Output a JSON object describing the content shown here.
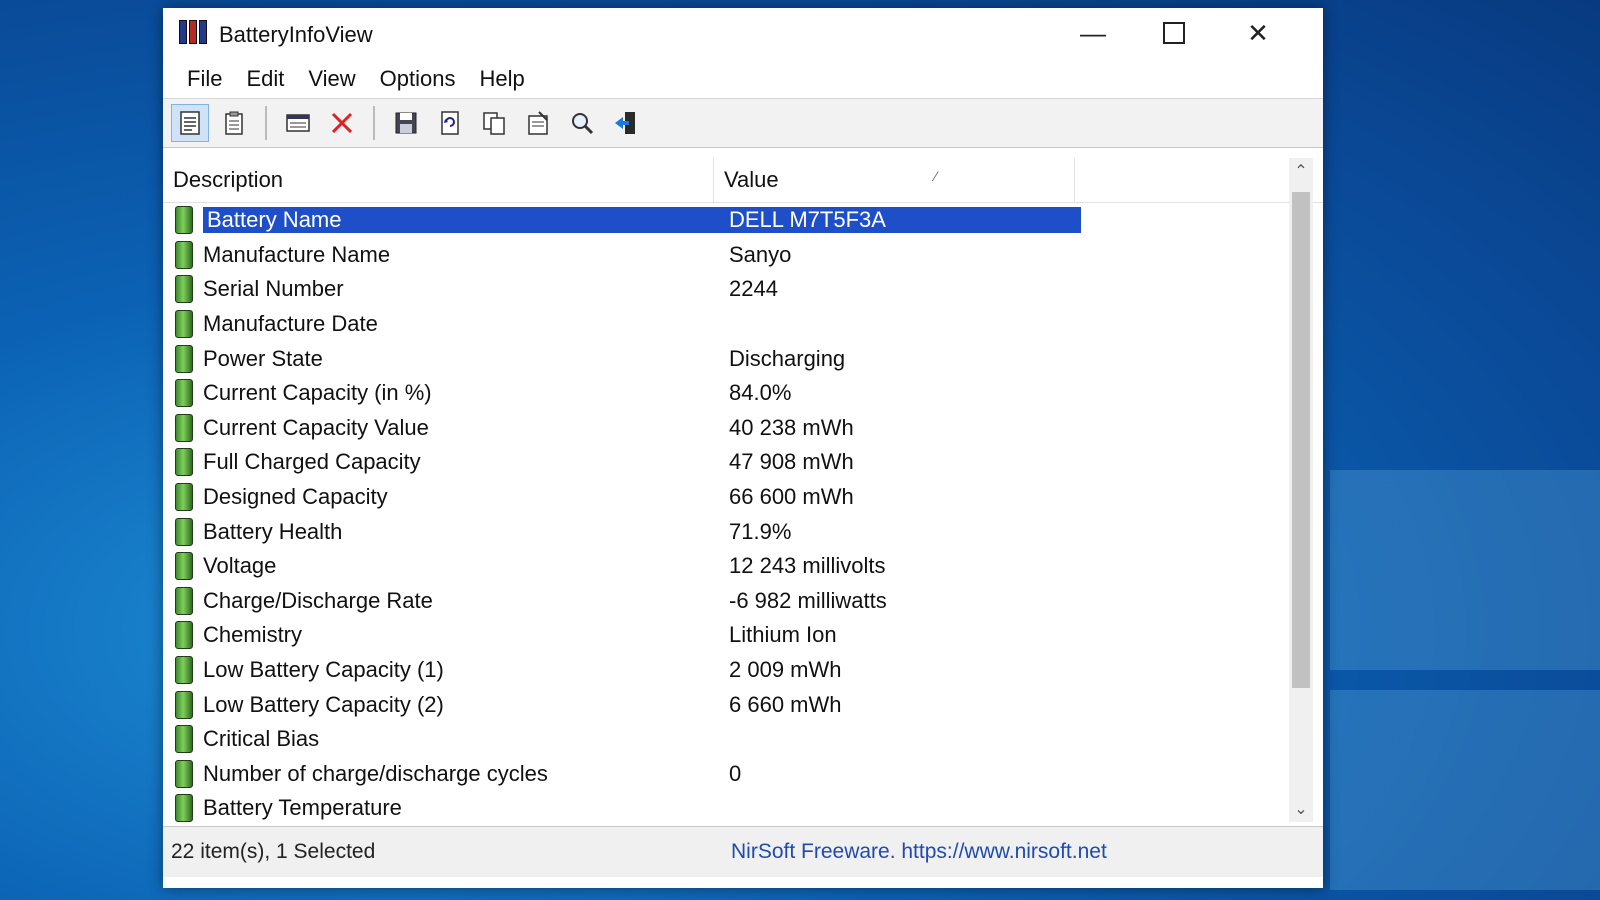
{
  "app": {
    "title": "BatteryInfoView"
  },
  "window_controls": {
    "minimize": "—",
    "close": "✕"
  },
  "menu": [
    "File",
    "Edit",
    "View",
    "Options",
    "Help"
  ],
  "toolbar": {
    "icons": [
      "html-report-icon",
      "report-icon",
      "properties-list-icon",
      "delete-icon",
      "save-icon",
      "refresh-icon",
      "copy-icon",
      "properties-icon",
      "find-icon",
      "exit-icon"
    ]
  },
  "list": {
    "columns": {
      "description": "Description",
      "value": "Value"
    },
    "rows": [
      {
        "description": "Battery Name",
        "value": "DELL M7T5F3A",
        "selected": true
      },
      {
        "description": "Manufacture Name",
        "value": "Sanyo"
      },
      {
        "description": "Serial Number",
        "value": "2244"
      },
      {
        "description": "Manufacture Date",
        "value": ""
      },
      {
        "description": "Power State",
        "value": "Discharging"
      },
      {
        "description": "Current Capacity (in %)",
        "value": "84.0%"
      },
      {
        "description": "Current Capacity Value",
        "value": "40 238 mWh"
      },
      {
        "description": "Full Charged Capacity",
        "value": "47 908 mWh"
      },
      {
        "description": "Designed Capacity",
        "value": "66 600 mWh"
      },
      {
        "description": "Battery Health",
        "value": "71.9%"
      },
      {
        "description": "Voltage",
        "value": "12 243 millivolts"
      },
      {
        "description": "Charge/Discharge Rate",
        "value": "-6 982 milliwatts"
      },
      {
        "description": "Chemistry",
        "value": "Lithium Ion"
      },
      {
        "description": "Low Battery Capacity (1)",
        "value": "2 009 mWh"
      },
      {
        "description": "Low Battery Capacity (2)",
        "value": "6 660 mWh"
      },
      {
        "description": "Critical Bias",
        "value": ""
      },
      {
        "description": "Number of charge/discharge cycles",
        "value": "0"
      },
      {
        "description": "Battery Temperature",
        "value": ""
      }
    ]
  },
  "status": {
    "items": "22 item(s), 1 Selected",
    "link": "NirSoft Freeware. https://www.nirsoft.net"
  },
  "colors": {
    "selection": "#1e4fc9",
    "link": "#1f4bb0",
    "desktop": "#0b62b4"
  }
}
